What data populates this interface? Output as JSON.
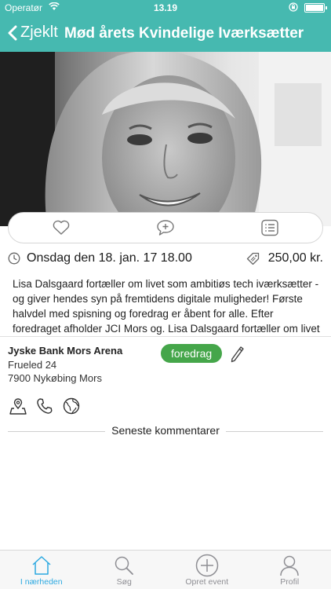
{
  "status_bar": {
    "carrier": "Operatør",
    "time": "13.19",
    "battery_level": 1.0
  },
  "nav": {
    "back_label": "Zjeklt",
    "title": "Mød årets Kvindelige Iværksætter"
  },
  "hero": {
    "image_subject": "portrait photo of smiling blonde woman, black and white"
  },
  "actions": {
    "icons": [
      "heart-icon",
      "comment-add-icon",
      "list-icon"
    ]
  },
  "event": {
    "date": "Onsdag den 18. jan. 17 18.00",
    "price": "250,00 kr.",
    "description": "Lisa Dalsgaard fortæller om livet som ambitiøs tech iværksætter - og giver hendes syn på fremtidens digitale muligheder! Første halvdel med spisning og foredrag er åbent for alle. Efter foredraget afholder JCI Mors og.  Lisa Dalsgaard fortæller om livet som ambitiøs tech iværksætter - og giver hendes syn på fremtidens digitale muligheder! Første halvdel med spisning og foredrag er åbent for alle."
  },
  "venue": {
    "name": "Jyske Bank Mors Arena",
    "street": "Frueled 24",
    "city": "7900 Nykøbing Mors"
  },
  "category_tag": "foredrag",
  "contacts": {
    "icons": [
      "map-pin-icon",
      "phone-icon",
      "globe-icon"
    ]
  },
  "comments": {
    "header": "Seneste kommentarer"
  },
  "tabbar": {
    "items": [
      {
        "label": "I nærheden",
        "icon": "home-icon",
        "active": true
      },
      {
        "label": "Søg",
        "icon": "search-icon",
        "active": false
      },
      {
        "label": "Opret event",
        "icon": "plus-circle-icon",
        "active": false
      },
      {
        "label": "Profil",
        "icon": "profile-icon",
        "active": false
      }
    ]
  },
  "colors": {
    "accent": "#46b9b0",
    "tag": "#45a64a",
    "tab_active": "#2ca9e1",
    "tab_inactive": "#8e8e93"
  }
}
